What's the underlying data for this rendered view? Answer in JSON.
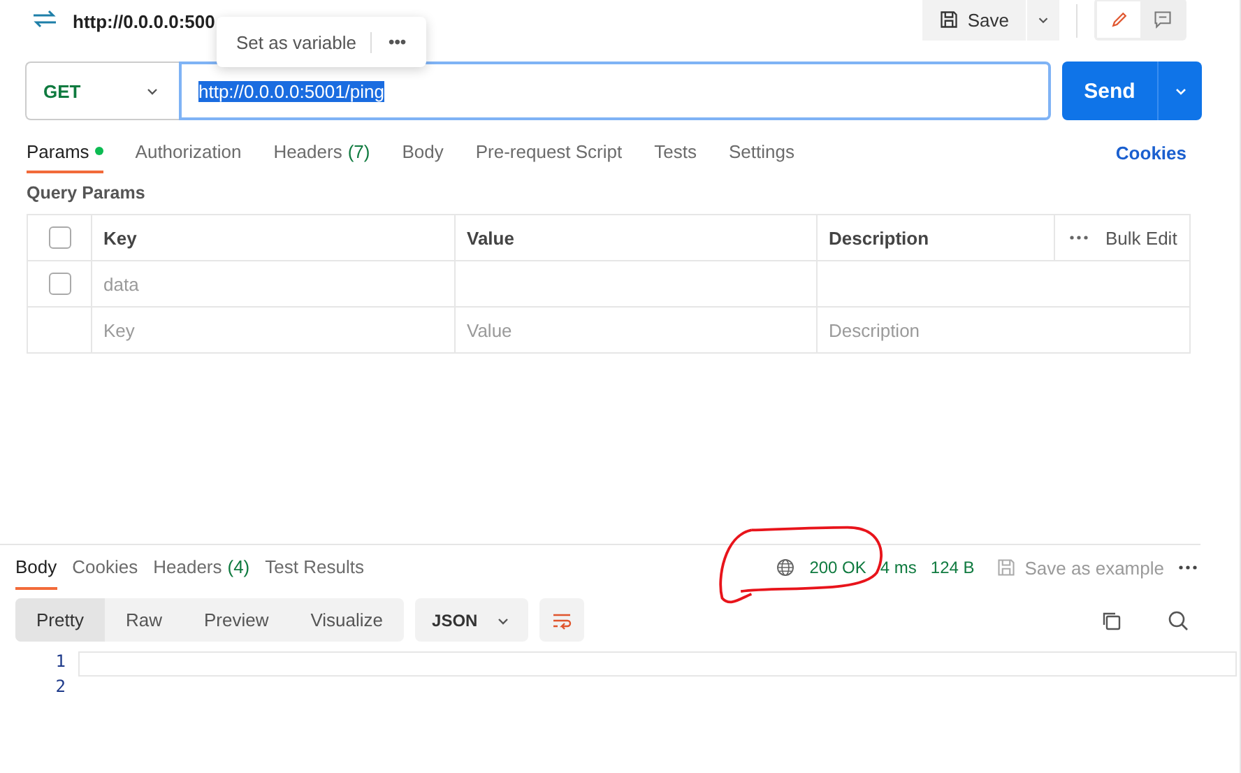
{
  "request_title": "http://0.0.0.0:500",
  "popover": {
    "label": "Set as variable",
    "more": "•••"
  },
  "save_button": "Save",
  "method": "GET",
  "url": "http://0.0.0.0:5001/ping",
  "url_selected": true,
  "send_button": "Send",
  "request_tabs": [
    {
      "label": "Params",
      "dot": true,
      "selected": true
    },
    {
      "label": "Authorization",
      "dot": false,
      "selected": false
    },
    {
      "label": "Headers",
      "count": "(7)",
      "dot": false,
      "selected": false
    },
    {
      "label": "Body",
      "dot": false,
      "selected": false
    },
    {
      "label": "Pre-request Script",
      "dot": false,
      "selected": false
    },
    {
      "label": "Tests",
      "dot": false,
      "selected": false
    },
    {
      "label": "Settings",
      "dot": false,
      "selected": false
    }
  ],
  "cookies_link": "Cookies",
  "section_title": "Query Params",
  "table": {
    "columns": [
      "Key",
      "Value",
      "Description"
    ],
    "header_checked": false,
    "bulk_edit": "Bulk Edit",
    "rows": [
      {
        "key": "data",
        "checked": false
      }
    ],
    "placeholder_row": [
      "Key",
      "Value",
      "Description"
    ]
  },
  "response_tabs": [
    {
      "label": "Body",
      "selected": true
    },
    {
      "label": "Cookies",
      "selected": false
    },
    {
      "label": "Headers",
      "count": "(4)",
      "selected": false
    },
    {
      "label": "Test Results",
      "selected": false
    }
  ],
  "status": "200 OK",
  "time": "4 ms",
  "size": "124 B",
  "save_example": "Save as example",
  "view_modes": [
    {
      "label": "Pretty",
      "selected": true
    },
    {
      "label": "Raw",
      "selected": false
    },
    {
      "label": "Preview",
      "selected": false
    },
    {
      "label": "Visualize",
      "selected": false
    }
  ],
  "format": "JSON",
  "line_numbers": [
    "1",
    "2"
  ]
}
